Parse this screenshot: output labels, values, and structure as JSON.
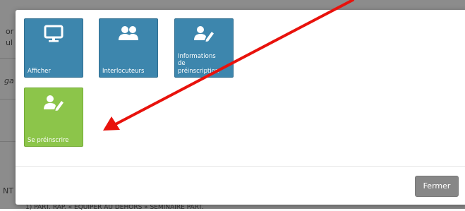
{
  "background": {
    "fragments": [
      "or",
      "ul",
      "ga",
      "NT"
    ],
    "bottom_text": "1) PART. RAP. « EQUIPER AU DEHORS » SEMINAIRE PART."
  },
  "modal": {
    "tiles": [
      {
        "label": "Afficher",
        "icon": "monitor-icon",
        "color": "#3d86ad"
      },
      {
        "label": "Interlocuteurs",
        "icon": "users-icon",
        "color": "#3d86ad"
      },
      {
        "label": "Informations de préinscription",
        "label_lines": [
          "Informations",
          "de",
          "préinscription"
        ],
        "icon": "user-edit-icon",
        "color": "#3d86ad"
      },
      {
        "label": "Se préinscrire",
        "icon": "user-edit-icon",
        "color": "#8cc54a"
      }
    ],
    "close_label": "Fermer"
  },
  "annotation": {
    "arrow_color": "#e8120c"
  }
}
